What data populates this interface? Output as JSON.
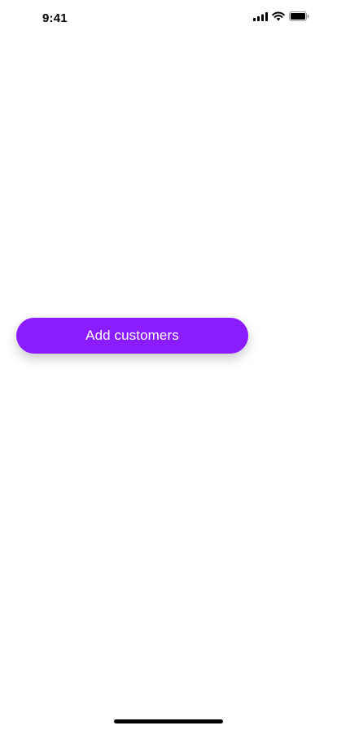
{
  "status_bar": {
    "time": "9:41",
    "icons": [
      "cellular-signal-icon",
      "wifi-icon",
      "battery-icon"
    ]
  },
  "main": {
    "add_customers_label": "Add customers"
  },
  "colors": {
    "accent": "#8a1cff",
    "background": "#ffffff",
    "text_on_accent": "#ffffff"
  }
}
